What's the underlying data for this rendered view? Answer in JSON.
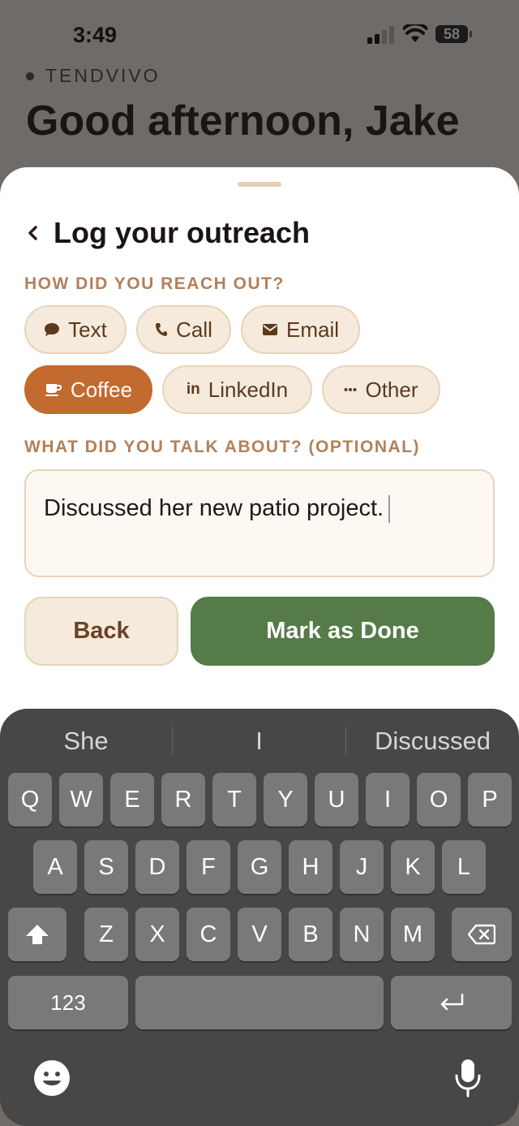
{
  "status": {
    "time": "3:49",
    "battery": "58"
  },
  "app": {
    "brand": "TENDVIVO",
    "greeting": "Good afternoon, Jake"
  },
  "sheet": {
    "title": "Log your outreach",
    "method_label": "HOW DID YOU REACH OUT?",
    "methods": [
      {
        "label": "Text",
        "icon": "chat-bubble-icon",
        "selected": false
      },
      {
        "label": "Call",
        "icon": "phone-icon",
        "selected": false
      },
      {
        "label": "Email",
        "icon": "envelope-icon",
        "selected": false
      },
      {
        "label": "Coffee",
        "icon": "coffee-cup-icon",
        "selected": true
      },
      {
        "label": "LinkedIn",
        "icon": "linkedin-icon",
        "selected": false
      },
      {
        "label": "Other",
        "icon": "ellipsis-icon",
        "selected": false
      }
    ],
    "notes_label": "WHAT DID YOU TALK ABOUT? (OPTIONAL)",
    "notes_value": "Discussed her new patio project.",
    "back_label": "Back",
    "done_label": "Mark as Done"
  },
  "keyboard": {
    "suggestions": [
      "She",
      "I",
      "Discussed"
    ],
    "row1": [
      "Q",
      "W",
      "E",
      "R",
      "T",
      "Y",
      "U",
      "I",
      "O",
      "P"
    ],
    "row2": [
      "A",
      "S",
      "D",
      "F",
      "G",
      "H",
      "J",
      "K",
      "L"
    ],
    "row3": [
      "Z",
      "X",
      "C",
      "V",
      "B",
      "N",
      "M"
    ],
    "numbers_label": "123"
  },
  "colors": {
    "accent_selected": "#c36a30",
    "primary_button": "#557b48",
    "section_label": "#b3805a"
  }
}
